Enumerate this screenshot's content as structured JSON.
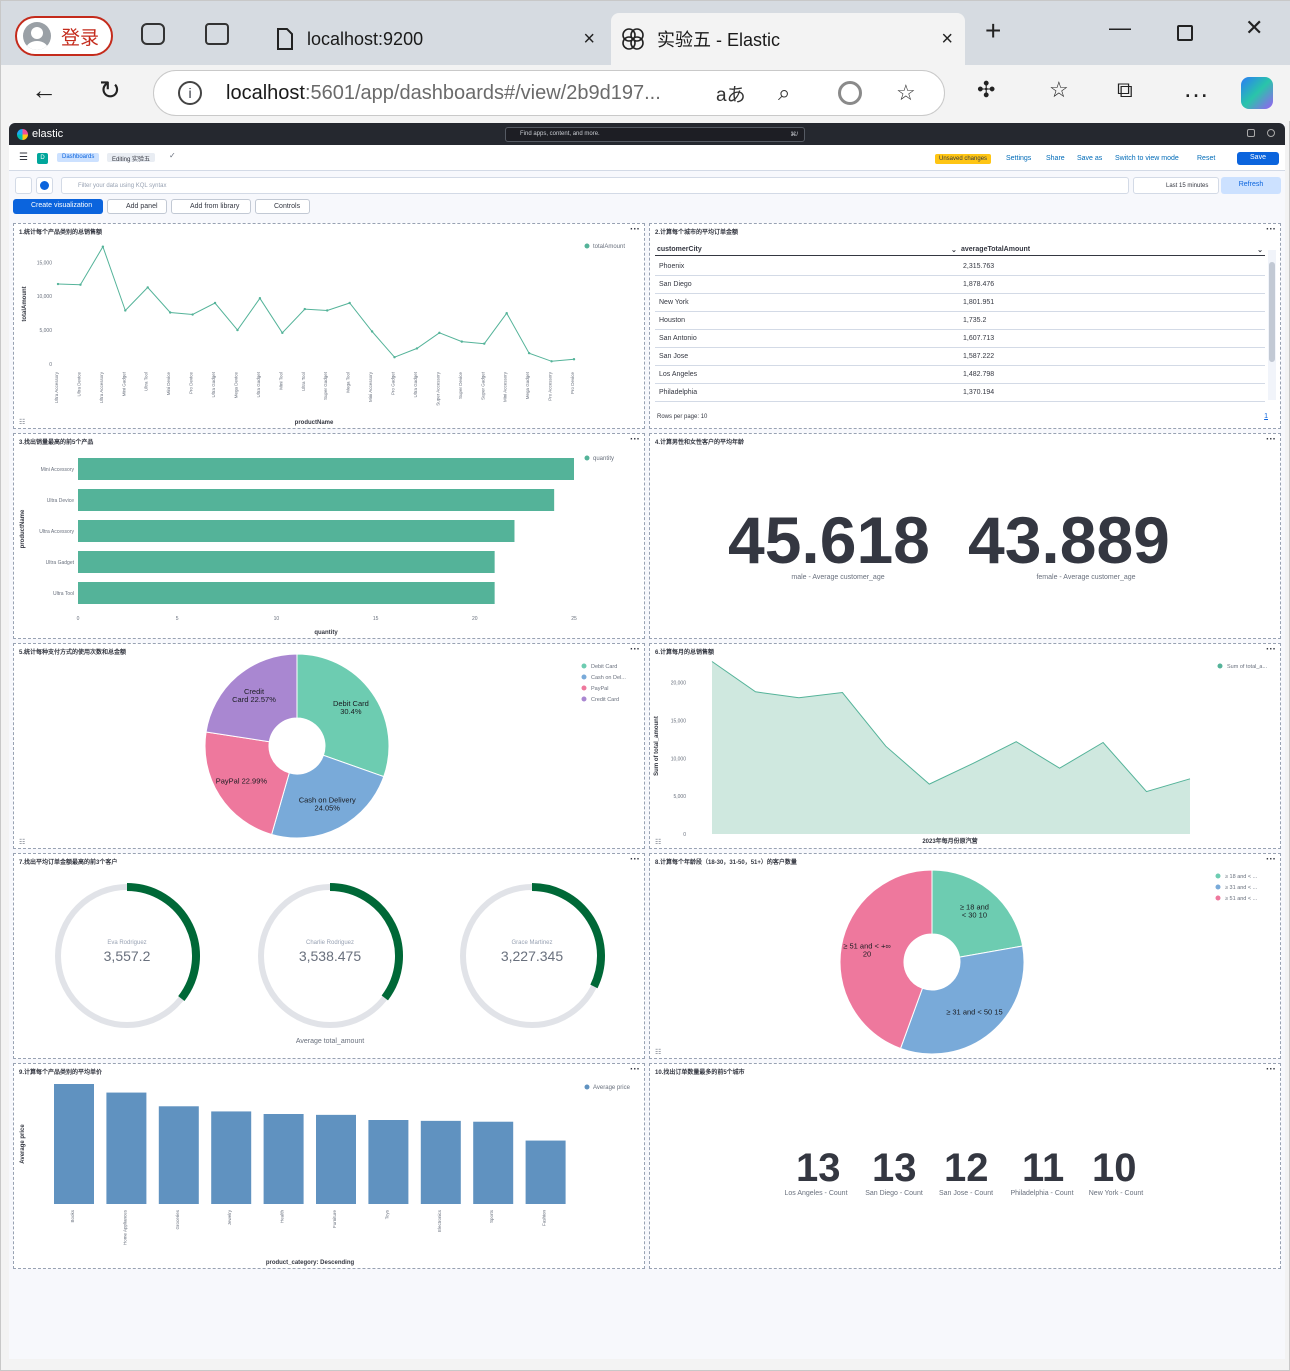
{
  "browser": {
    "login_label": "登录",
    "tabs": [
      {
        "title": "localhost:9200"
      },
      {
        "title": "实验五 - Elastic"
      }
    ],
    "url_host": "localhost",
    "url_path": ":5601/app/dashboards#/view/2b9d197...",
    "new_tab": "+",
    "close": "×"
  },
  "kibana": {
    "brand": "elastic",
    "search_placeholder": "Find apps, content, and more.",
    "search_shortcut": "⌘/",
    "space_letter": "D",
    "breadcrumb_dashboards": "Dashboards",
    "breadcrumb_editing": "Editing 实验五",
    "unsaved": "Unsaved changes",
    "header_links": [
      "Settings",
      "Share",
      "Save as",
      "Switch to view mode",
      "Reset"
    ],
    "save": "Save",
    "query_placeholder": "Filter your data using KQL syntax",
    "time_range": "Last 15 minutes",
    "refresh": "Refresh",
    "create_vis": "Create visualization",
    "add_panel": "Add panel",
    "add_library": "Add from library",
    "controls": "Controls"
  },
  "panels": {
    "p1": {
      "title": "1.统计每个产品类别的总销售额",
      "legend": "totalAmount",
      "ylabel": "totalAmount",
      "xlabel": "productName",
      "yticks": [
        "15,000",
        "10,000",
        "5,000",
        "0"
      ],
      "chart_data": {
        "type": "line",
        "ylim": [
          0,
          18000
        ],
        "categories": [
          "Ultra Accessory",
          "Ultra Device",
          "Ultra Accessory",
          "Mini Gadget",
          "Ultra Tool",
          "Mini Device",
          "Pro Device",
          "Ultra Gadget",
          "Mega Device",
          "Ultra Gadget",
          "Mini Tool",
          "Ultra Tool",
          "Super Gadget",
          "Mega Tool",
          "Mini Accessory",
          "Pro Gadget",
          "Ultra Gadget",
          "Super Accessory",
          "Super Device",
          "Super Gadget",
          "Mini Accessory",
          "Mega Gadget",
          "Pro Accessory",
          "Pro Device"
        ],
        "values": [
          11800,
          11700,
          17300,
          7900,
          11300,
          7600,
          7300,
          9000,
          5000,
          9700,
          4600,
          8100,
          7900,
          9000,
          4800,
          1000,
          2300,
          4600,
          3300,
          3000,
          7500,
          1600,
          400,
          700
        ]
      }
    },
    "p2": {
      "title": "2.计算每个城市的平均订单金额",
      "col1": "customerCity",
      "col2": "averageTotalAmount",
      "rows": [
        {
          "city": "Phoenix",
          "avg": "2,315.763"
        },
        {
          "city": "San Diego",
          "avg": "1,878.476"
        },
        {
          "city": "New York",
          "avg": "1,801.951"
        },
        {
          "city": "Houston",
          "avg": "1,735.2"
        },
        {
          "city": "San Antonio",
          "avg": "1,607.713"
        },
        {
          "city": "San Jose",
          "avg": "1,587.222"
        },
        {
          "city": "Los Angeles",
          "avg": "1,482.798"
        },
        {
          "city": "Philadelphia",
          "avg": "1,370.194"
        }
      ],
      "rows_per_page": "Rows per page: 10",
      "page": "1"
    },
    "p3": {
      "title": "3.找出销量最高的前5个产品",
      "legend": "quantity",
      "ylabel": "productName",
      "xlabel": "quantity",
      "chart_data": {
        "type": "bar",
        "categories": [
          "Mini Accessory",
          "Ultra Device",
          "Ultra Accessory",
          "Ultra Gadget",
          "Ultra Tool"
        ],
        "values": [
          25,
          24,
          22,
          21,
          21
        ],
        "xlim": [
          0,
          25
        ],
        "xticks": [
          "0",
          "5",
          "10",
          "15",
          "20",
          "25"
        ]
      }
    },
    "p4": {
      "title": "4.计算男性和女性客户的平均年龄",
      "metrics": [
        {
          "value": "45.618",
          "label": "male - Average customer_age"
        },
        {
          "value": "43.889",
          "label": "female - Average customer_age"
        }
      ]
    },
    "p5": {
      "title": "5.统计每种支付方式的使用次数和总金额",
      "chart_data": {
        "type": "pie",
        "labels": [
          "Debit Card",
          "Cash on Delivery",
          "PayPal",
          "Credit Card"
        ],
        "legend_labels": [
          "Debit Card",
          "Cash on Del...",
          "PayPal",
          "Credit Card"
        ],
        "values": [
          30.4,
          24.05,
          22.99,
          22.57
        ],
        "slice_labels": [
          "Debit Card\n30.4%",
          "Cash on Delivery\n24.05%",
          "PayPal 22.99%",
          "Credit\nCard 22.57%"
        ],
        "colors": [
          "#6dccb1",
          "#79aad9",
          "#ee789d",
          "#a987d1"
        ]
      }
    },
    "p6": {
      "title": "6.计算每月的总销售额",
      "legend": "Sum of total_a...",
      "ylabel": "Sum of total_amount",
      "xlabel": "2023年每月份原汽营",
      "yticks": [
        "20,000",
        "15,000",
        "10,000",
        "5,000",
        "0"
      ],
      "chart_data": {
        "type": "area",
        "ylim": [
          0,
          23000
        ],
        "values": [
          22800,
          18800,
          18000,
          18700,
          11600,
          6600,
          9300,
          12200,
          8700,
          12100,
          5600,
          7300
        ]
      }
    },
    "p7": {
      "title": "7.找出平均订单金额最高的前3个客户",
      "footer": "Average total_amount",
      "chart_data": {
        "type": "gauge",
        "max": 10000,
        "items": [
          {
            "name": "Eva Rodriguez",
            "value": "3,557.2",
            "v": 3557.2
          },
          {
            "name": "Charlie Rodriguez",
            "value": "3,538.475",
            "v": 3538.475
          },
          {
            "name": "Grace Martinez",
            "value": "3,227.345",
            "v": 3227.345
          }
        ]
      },
      "accent": "#006837"
    },
    "p8": {
      "title": "8.计算每个年龄段（18-30，31-50，51+）的客户数量",
      "chart_data": {
        "type": "pie",
        "labels": [
          "≥ 18 and < 30",
          "≥ 31 and < 50",
          "≥ 51 and < +∞"
        ],
        "legend_labels": [
          "≥ 18 and < ...",
          "≥ 31 and < ...",
          "≥ 51 and < ..."
        ],
        "values": [
          10,
          15,
          20
        ],
        "slice_labels": [
          "≥ 18 and\n< 30 10",
          "≥ 31 and < 50 15",
          "≥ 51 and < +∞\n20"
        ],
        "colors": [
          "#6dccb1",
          "#79aad9",
          "#ee789d"
        ]
      }
    },
    "p9": {
      "title": "9.计算每个产品类别的平均单价",
      "legend": "Average price",
      "ylabel": "Average price",
      "xlabel": "product_category: Descending",
      "chart_data": {
        "type": "bar",
        "categories": [
          "Books",
          "Home Appliances",
          "Groceries",
          "Jewelry",
          "Health",
          "Furniture",
          "Toys",
          "Electronics",
          "Sports",
          "Fashion"
        ],
        "values": [
          700,
          650,
          570,
          540,
          525,
          520,
          490,
          485,
          480,
          370
        ],
        "ylim": [
          0,
          700
        ]
      }
    },
    "p10": {
      "title": "10.找出订单数量最多的前5个城市",
      "metrics": [
        {
          "value": "13",
          "label": "Los Angeles - Count"
        },
        {
          "value": "13",
          "label": "San Diego - Count"
        },
        {
          "value": "12",
          "label": "San Jose - Count"
        },
        {
          "value": "11",
          "label": "Philadelphia - Count"
        },
        {
          "value": "10",
          "label": "New York - Count"
        }
      ]
    }
  },
  "colors": {
    "teal": "#54b399",
    "blue": "#6092c0",
    "kibana_blue": "#0b64dd",
    "badge_yellow": "#fec514",
    "gauge_green": "#006837"
  }
}
